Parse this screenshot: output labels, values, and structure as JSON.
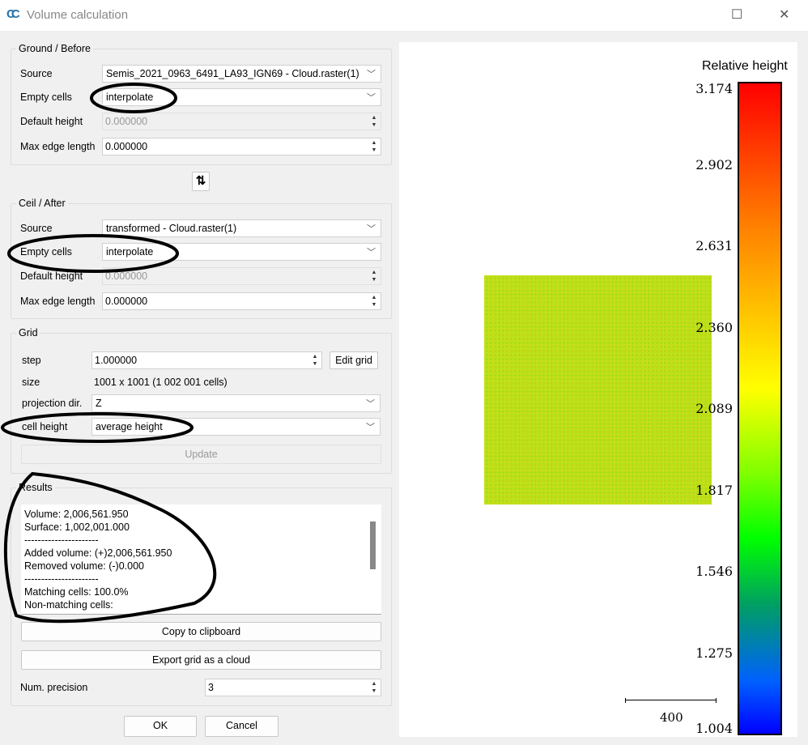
{
  "window": {
    "title": "Volume calculation",
    "logo": "CC",
    "maximize_icon": "maximize-icon",
    "close_icon": "close-icon"
  },
  "ground": {
    "title": "Ground / Before",
    "source_label": "Source",
    "source_value": "Semis_2021_0963_6491_LA93_IGN69 - Cloud.raster(1)",
    "empty_label": "Empty cells",
    "empty_value": "interpolate",
    "default_label": "Default height",
    "default_value": "0.000000",
    "maxedge_label": "Max edge length",
    "maxedge_value": "0.000000"
  },
  "swap_icon": "swap-arrows-icon",
  "ceil": {
    "title": "Ceil / After",
    "source_label": "Source",
    "source_value": "transformed - Cloud.raster(1)",
    "empty_label": "Empty cells",
    "empty_value": "interpolate",
    "default_label": "Default height",
    "default_value": "0.000000",
    "maxedge_label": "Max edge length",
    "maxedge_value": "0.000000"
  },
  "grid": {
    "title": "Grid",
    "step_label": "step",
    "step_value": "1.000000",
    "edit_grid": "Edit grid",
    "size_label": "size",
    "size_value": "1001 x 1001 (1 002 001 cells)",
    "proj_label": "projection dir.",
    "proj_value": "Z",
    "cellh_label": "cell height",
    "cellh_value": "average height",
    "update": "Update"
  },
  "results": {
    "title": "Results",
    "lines": [
      "Volume: 2,006,561.950",
      "Surface: 1,002,001.000",
      "----------------------",
      "Added volume: (+)2,006,561.950",
      "Removed volume: (-)0.000",
      "----------------------",
      "Matching cells: 100.0%",
      "Non-matching cells:"
    ]
  },
  "buttons": {
    "copy": "Copy to clipboard",
    "export": "Export grid as a cloud",
    "ok": "OK",
    "cancel": "Cancel"
  },
  "precision": {
    "label": "Num. precision",
    "value": "3"
  },
  "colorbar": {
    "title": "Relative height",
    "ticks": [
      "3.174",
      "2.902",
      "2.631",
      "2.360",
      "2.089",
      "1.817",
      "1.546",
      "1.275",
      "1.004"
    ],
    "colors": [
      "#ff0000",
      "#ffff00",
      "#00ff00",
      "#0000ff"
    ]
  },
  "scale": {
    "label": "400"
  }
}
